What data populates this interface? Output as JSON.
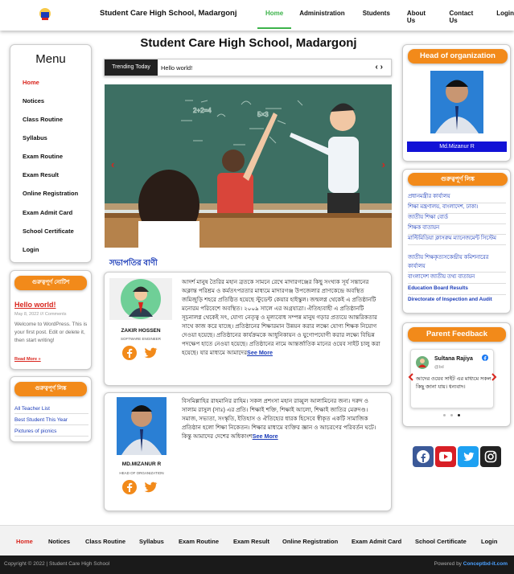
{
  "site": {
    "title": "Student Care High School, Madargonj",
    "page_heading": "Student Care High School, Madargonj"
  },
  "top_nav": [
    "Home",
    "Administration",
    "Students",
    "About Us",
    "Contact Us",
    "Login"
  ],
  "menu": {
    "title": "Menu",
    "items": [
      "Home",
      "Notices",
      "Class Routine",
      "Syllabus",
      "Exam Routine",
      "Exam Result",
      "Online Registration",
      "Exam Admit Card",
      "School Certificate",
      "Login"
    ]
  },
  "notice_widget": {
    "heading": "গুরুত্বপূর্ণ নোটিশ",
    "post_title": "Hello world!",
    "post_meta": "May 8, 2022 /// Comments",
    "post_excerpt": "Welcome to WordPress. This is your first post. Edit or delete it, then start writing!",
    "read_more": "Read More »"
  },
  "left_links": {
    "heading": "গুরুত্বপূর্ণ লিঙ্ক",
    "items": [
      "All Teacher List",
      "Best Student This Year",
      "Pictures of picnics"
    ]
  },
  "trending": {
    "label": "Trending Today",
    "text": "Hello world!",
    "prev": "‹",
    "next": "›"
  },
  "slider": {
    "prev": "‹",
    "next": "›"
  },
  "speech_section": {
    "heading": "সভাপতির বাণী"
  },
  "messages": [
    {
      "name": "ZAKIR HOSSEN",
      "role": "SOFTWARE ENGINEER",
      "text": "আদর্শ মানুষ তৈরির মহান ব্রতকে সামনে রেখে মাদারগঞ্জের কিছু সংখ্যক সূর্য সন্তানের অক্লান্ত পরিশ্রম ও কর্মতৎপরতার মাধ্যমে মাদারগঞ্জ উপজেলার প্রাণকেন্দ্রে অবস্থিত জমিজুড়ি শহরে প্রতিষ্ঠিত হয়েছে স্টুডেন্ট কেয়ার হাইস্কুল। জন্মলগ্ন থেকেই এ প্রতিষ্ঠানটি মনোরম পরিবেশে অবস্থিত। ২০০৯ সালে এর অগ্রযাত্রা। ঐতিহ্যবাহী এ প্রতিষ্ঠানটি সূচনালগ্ন থেকেই সৎ, যোগ্য নেতৃত্ব ও মূল্যবোধ সম্পন্ন মানুষ গড়ার প্রত্যয়ে আন্তরিকতার সাথে কাজ করে যাচ্ছে। প্রতিষ্ঠানের শিক্ষারমান উন্নয়ন করার লক্ষ্যে যোগ্য শিক্ষক নিয়োগ দেওয়া হয়েছে। প্রতিষ্ঠানের কার্যক্রমকে আধুনিকায়ন ও যুগোপযোগী করার লক্ষ্যে বিভিন্ন পদক্ষেপ হাতে নেওয়া হয়েছে। প্রতিষ্ঠানের নামে আন্তর্জাতিক মানের ওয়েব সাইট চালু করা হয়েছে। যার মাধ্যমে আমাদের",
      "more": "See More"
    },
    {
      "name": "MD.MIZANUR R",
      "role": "HEAD OF ORGANIZATION",
      "text": "বিসমিল্লাহির রাহমানির রাহিম। সকল প্রশংসা মহান রাব্বুল আলামিনের জন্য। দরুদ ও সালাম রাসুল (সাঃ) এর প্রতি। শিক্ষাই শক্তি, শিক্ষাই আলো, শিক্ষাই জাতির মেরুদণ্ড। সমাজ, সভ্যতা, সংস্কৃতি, ইতিহাস ও ঐতিহ্যের ধারক হিসেবে স্বীকৃত একটি সামাজিক প্রতিষ্ঠান হলো শিক্ষা নিকেতন। শিক্ষার মাধ্যমে ব্যক্তির জ্ঞান ও আচরণের পরিবর্তন ঘটে। কিন্তু আমাদের দেশের অধিকাংশ",
      "more": "See More"
    }
  ],
  "head_of_org": {
    "heading": "Head of organization",
    "name": "Md.Mizanur R"
  },
  "right_links": {
    "heading": "গুরুত্বপূর্ণ লিঙ্ক",
    "items": [
      "প্রধানমন্ত্রীর কার্যালয়",
      "শিক্ষা মন্ত্রণালয়, বাংলাদেশ, ঢাকা।",
      "জাতীয় শিক্ষা বোর্ড",
      "শিক্ষক বাতায়ন",
      "মাল্টিমিডিয়া ক্লাসরুম ম্যানেজমেন্ট সিস্টেম",
      "জাতীয় শিক্ষকৃত্যসকেন্দ্রীয় কমিশনারের কার্যালয়",
      "বাংলাদেশ জাতীয় তথ্য বাতায়ন",
      "Education Board Results",
      "Directorate of Inspection and Audit"
    ]
  },
  "feedback": {
    "heading": "Parent Feedback",
    "name": "Sultana Rajiya",
    "handle": "@bd",
    "text": "আদের ওয়েব সাইট এর মাধ্যমে সকল কিছু জানা যায়। ধন্যবাদ।"
  },
  "footer_nav": [
    "Home",
    "Notices",
    "Class Routine",
    "Syllabus",
    "Exam Routine",
    "Exam Result",
    "Online Registration",
    "Exam Admit Card",
    "School Certificate",
    "Login"
  ],
  "footer": {
    "copyright": "Copyright © 2022 | Student Care High School",
    "powered_prefix": "Powered by ",
    "powered_brand": "Conceptbd-it.com"
  },
  "colors": {
    "accent_green": "#3cb34a",
    "accent_orange": "#f28a1a",
    "link_blue": "#1a3bb8",
    "active_red": "#d9251d"
  }
}
